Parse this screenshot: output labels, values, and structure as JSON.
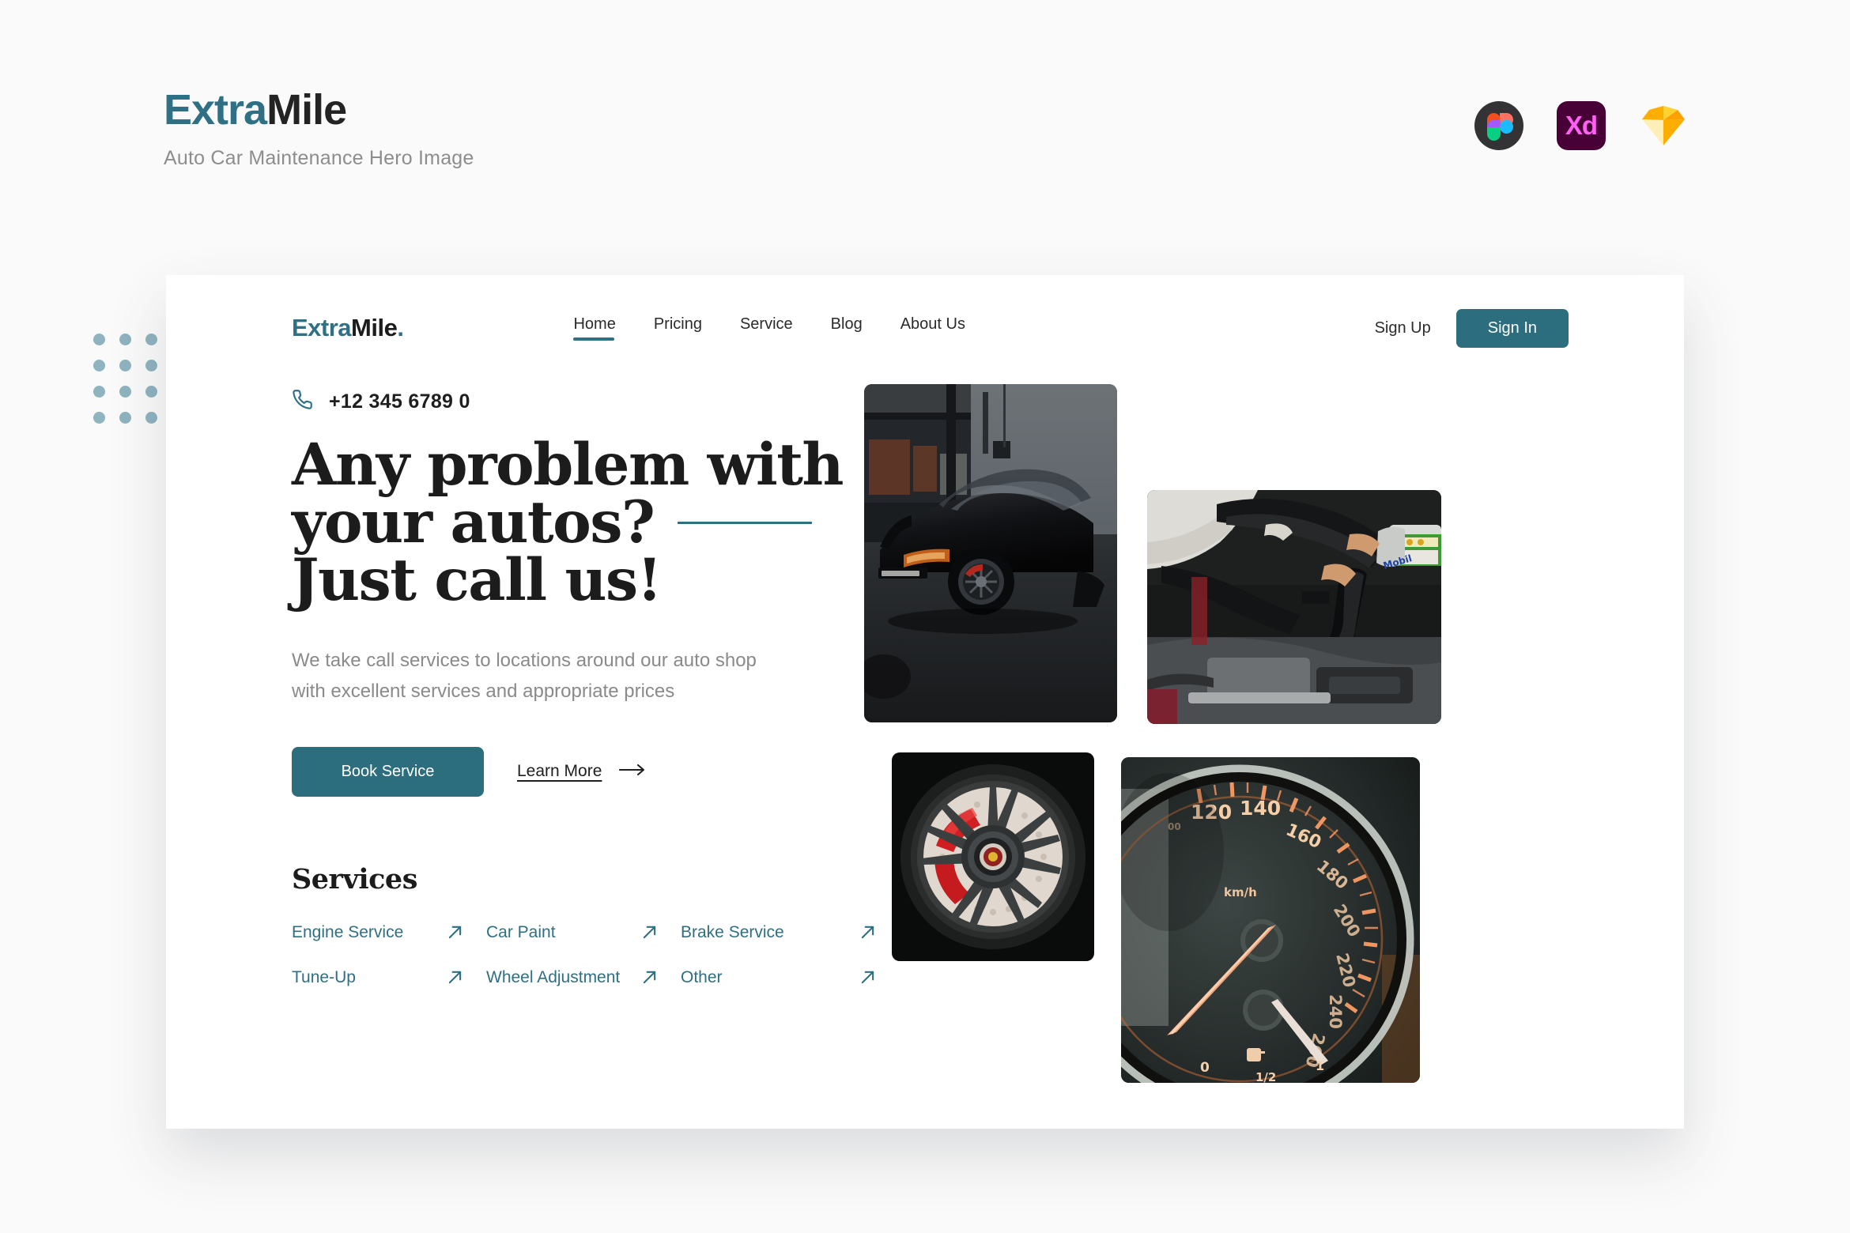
{
  "page_header": {
    "brand_first": "Extra",
    "brand_second": "Mile",
    "subtitle": "Auto Car Maintenance Hero Image"
  },
  "tool_icons": [
    {
      "name": "figma-icon",
      "label": ""
    },
    {
      "name": "adobe-xd-icon",
      "label": "Xd"
    },
    {
      "name": "sketch-icon",
      "label": ""
    }
  ],
  "mock": {
    "navbar": {
      "logo_first": "Extra",
      "logo_second": "Mile",
      "logo_dot": ".",
      "links": [
        {
          "label": "Home",
          "active": true
        },
        {
          "label": "Pricing",
          "active": false
        },
        {
          "label": "Service",
          "active": false
        },
        {
          "label": "Blog",
          "active": false
        },
        {
          "label": "About Us",
          "active": false
        }
      ],
      "sign_up": "Sign Up",
      "sign_in": "Sign In"
    },
    "hero": {
      "phone": "+12 345 6789 0",
      "headline_line1": "Any problem with",
      "headline_line2": "your autos?",
      "headline_line3": "Just call us!",
      "body": "We take call services to locations around our auto shop with excellent services and appropriate prices",
      "primary_cta": "Book Service",
      "secondary_cta": "Learn More"
    },
    "services": {
      "title": "Services",
      "items": [
        {
          "label": "Engine Service"
        },
        {
          "label": "Car Paint"
        },
        {
          "label": "Brake Service"
        },
        {
          "label": "Tune-Up"
        },
        {
          "label": "Wheel Adjustment"
        },
        {
          "label": "Other"
        }
      ]
    },
    "collage": [
      {
        "name": "photo-sports-car-in-garage",
        "alt": "Black sports car parked in a workshop garage"
      },
      {
        "name": "photo-mechanic-pouring-oil",
        "alt": "Mechanic pouring engine oil into an open car engine bay"
      },
      {
        "name": "photo-alloy-wheel-brake",
        "alt": "Close-up of an alloy wheel with red brake caliper and drilled rotor"
      },
      {
        "name": "photo-speedometer",
        "alt": "Close-up of a car speedometer dial"
      }
    ],
    "speedometer_readout": {
      "unit": "km/h",
      "ticks": [
        "120",
        "140",
        "160",
        "180",
        "200",
        "220",
        "240",
        "260"
      ],
      "fuel_labels": [
        "0",
        "1/2",
        "1"
      ]
    }
  },
  "colors": {
    "accent_teal": "#2d6e7e",
    "logo_teal": "#2f7084",
    "dot_grid": "#8fb3bf",
    "page_bg": "#fafafa",
    "card_bg": "#ffffff",
    "heading": "#1c1c1c",
    "muted_text": "#8a8a8a"
  }
}
